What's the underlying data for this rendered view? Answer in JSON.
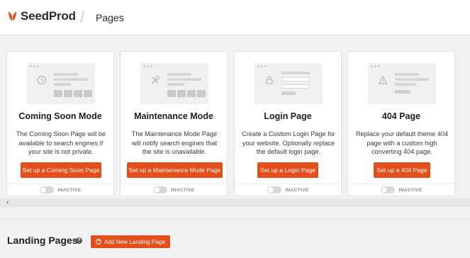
{
  "header": {
    "brand": "SeedProd",
    "separator": "/",
    "page_title": "Pages"
  },
  "cards": [
    {
      "title": "Coming Soon Mode",
      "description": "The Coming Soon Page will be available to search engines if your site is not private.",
      "button_label": "Set up a Coming Soon Page",
      "status": "INACTIVE",
      "icon": "clock-icon"
    },
    {
      "title": "Maintenance Mode",
      "description": "The Maintenance Mode Page will notify search engines that the site is unavailable.",
      "button_label": "Set up a Maintenance Mode Page",
      "status": "INACTIVE",
      "icon": "tools-icon"
    },
    {
      "title": "Login Page",
      "description": "Create a Custom Login Page for your website. Optionally replace the default login page.",
      "button_label": "Set up a Login Page",
      "status": "INACTIVE",
      "icon": "lock-icon"
    },
    {
      "title": "404 Page",
      "description": "Replace your default theme 404 page with a custom high converting 404 page.",
      "button_label": "Set up a 404 Page",
      "status": "INACTIVE",
      "icon": "warning-icon"
    }
  ],
  "scroll": {
    "left_arrow": "‹"
  },
  "landing": {
    "title": "Landing Pages",
    "help": "?",
    "add_button_label": "Add New Landing Page",
    "add_icon": "+"
  },
  "colors": {
    "accent": "#e44e1a",
    "background": "#f1f1f1"
  }
}
